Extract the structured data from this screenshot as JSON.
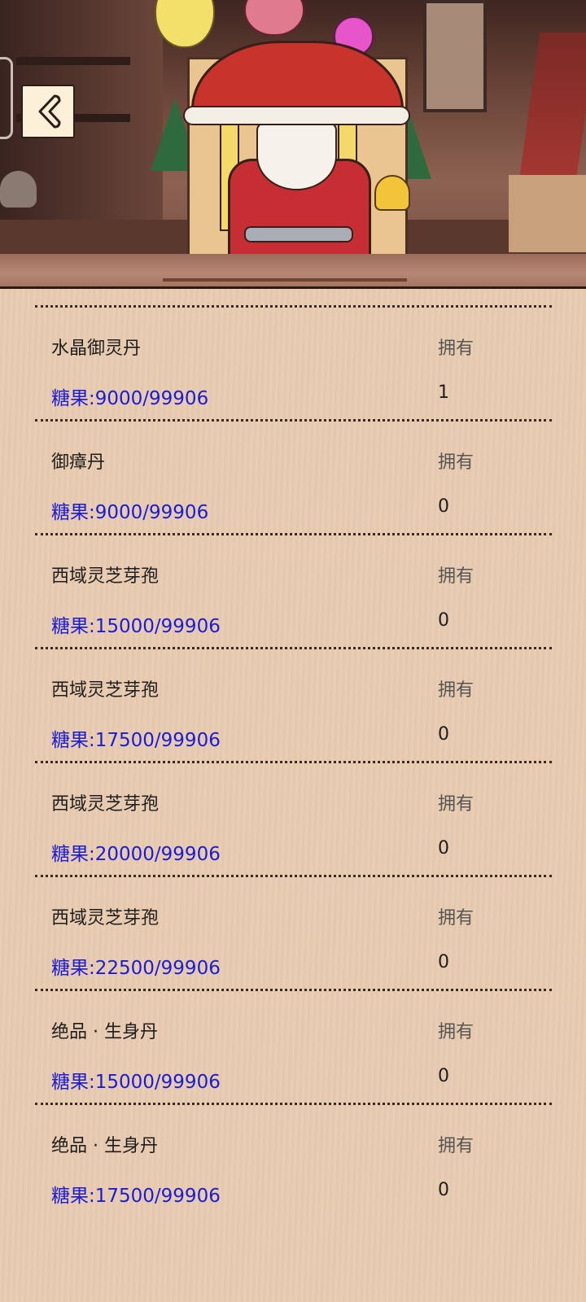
{
  "header": {
    "back_icon": "chevron-left-icon"
  },
  "items": [
    {
      "name": "水晶御灵丹",
      "price": "糖果:9000/99906",
      "own_label": "拥有",
      "own_count": "1"
    },
    {
      "name": "御瘴丹",
      "price": "糖果:9000/99906",
      "own_label": "拥有",
      "own_count": "0"
    },
    {
      "name": "西域灵芝芽孢",
      "price": "糖果:15000/99906",
      "own_label": "拥有",
      "own_count": "0"
    },
    {
      "name": "西域灵芝芽孢",
      "price": "糖果:17500/99906",
      "own_label": "拥有",
      "own_count": "0"
    },
    {
      "name": "西域灵芝芽孢",
      "price": "糖果:20000/99906",
      "own_label": "拥有",
      "own_count": "0"
    },
    {
      "name": "西域灵芝芽孢",
      "price": "糖果:22500/99906",
      "own_label": "拥有",
      "own_count": "0"
    },
    {
      "name": "绝品 · 生身丹",
      "price": "糖果:15000/99906",
      "own_label": "拥有",
      "own_count": "0"
    },
    {
      "name": "绝品 · 生身丹",
      "price": "糖果:17500/99906",
      "own_label": "拥有",
      "own_count": "0"
    }
  ],
  "colors": {
    "price_text": "#1b1cd6",
    "background": "#e8cbb0"
  }
}
